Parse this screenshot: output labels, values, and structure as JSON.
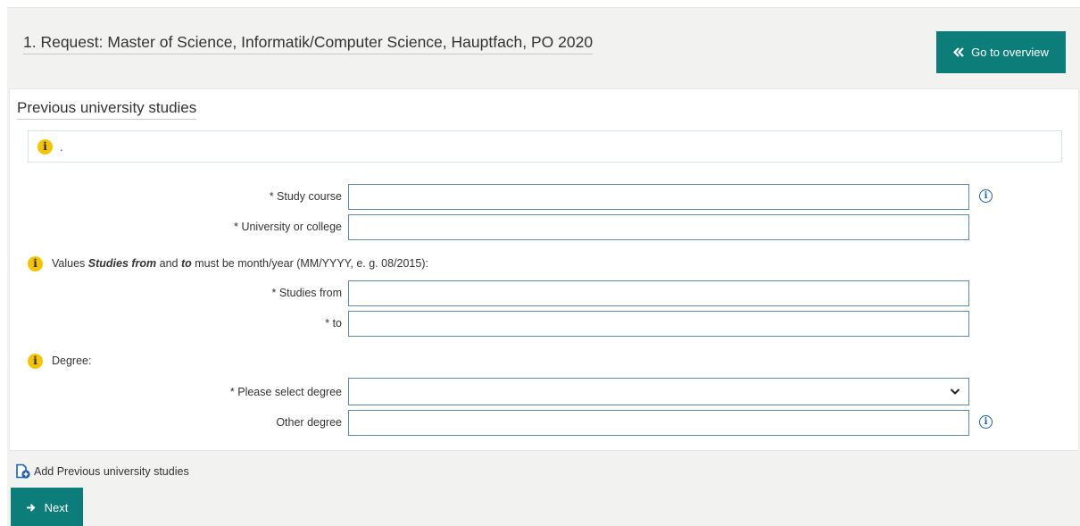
{
  "header": {
    "request_title": "1. Request: Master of Science, Informatik/Computer Science, Hauptfach, PO 2020",
    "overview_button": "Go to overview",
    "accent_color": "#0d7d7a"
  },
  "section": {
    "title": "Previous university studies",
    "info_text": "."
  },
  "fields": {
    "study_course": {
      "label": "* Study course",
      "value": ""
    },
    "university": {
      "label": "* University or college",
      "value": ""
    },
    "studies_from": {
      "label": "* Studies from",
      "value": ""
    },
    "studies_to": {
      "label": "* to",
      "value": ""
    },
    "degree_select": {
      "label": "* Please select degree",
      "value": ""
    },
    "other_degree": {
      "label": "Other degree",
      "value": ""
    }
  },
  "notes": {
    "dates_prefix": "Values ",
    "dates_bold1": "Studies from",
    "dates_mid": " and ",
    "dates_bold2": "to",
    "dates_suffix": " must be month/year (MM/YYYY, e. g. 08/2015):",
    "degree": "Degree:"
  },
  "footer": {
    "add_link": "Add Previous university studies",
    "next_button": "Next"
  },
  "icons": {
    "info": "info-circle-yellow",
    "help": "info-outline-blue",
    "overview": "double-chevron-left",
    "add": "document-add",
    "next": "arrow-right"
  }
}
